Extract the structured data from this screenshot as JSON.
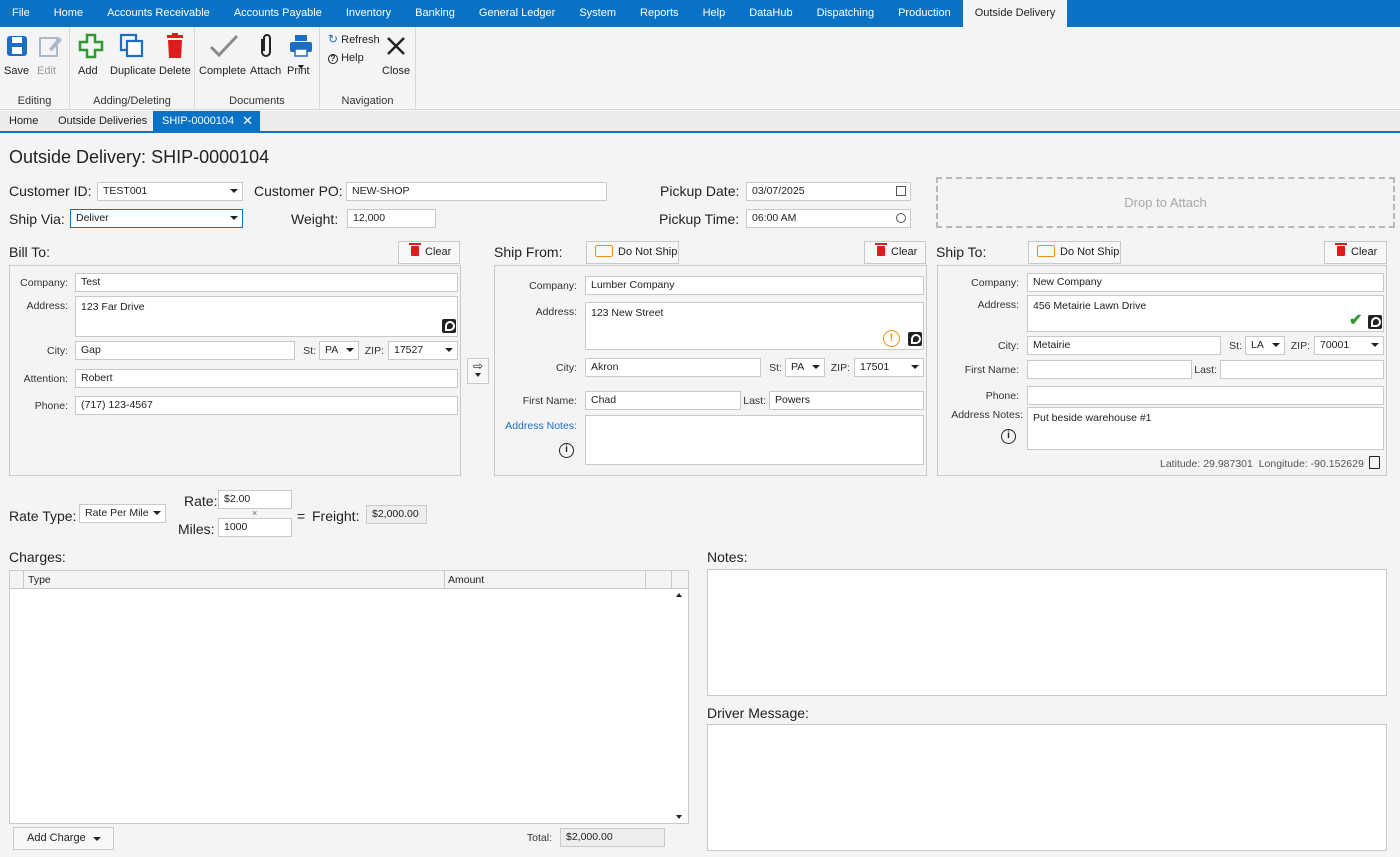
{
  "menu": [
    "File",
    "Home",
    "Accounts Receivable",
    "Accounts Payable",
    "Inventory",
    "Banking",
    "General Ledger",
    "System",
    "Reports",
    "Help",
    "DataHub",
    "Dispatching",
    "Production",
    "Outside Delivery"
  ],
  "ribbon": {
    "editing": {
      "label": "Editing",
      "save": "Save",
      "edit": "Edit"
    },
    "adding": {
      "label": "Adding/Deleting",
      "add": "Add",
      "duplicate": "Duplicate",
      "delete": "Delete"
    },
    "documents": {
      "label": "Documents",
      "complete": "Complete",
      "attach": "Attach",
      "print": "Print"
    },
    "navigation": {
      "label": "Navigation",
      "refresh": "Refresh",
      "help": "Help",
      "close": "Close"
    }
  },
  "tabs": [
    "Home",
    "Outside Deliveries",
    "SHIP-0000104"
  ],
  "title": {
    "prefix": "Outside Delivery:",
    "number": "SHIP-0000104"
  },
  "header": {
    "customer_id_label": "Customer ID:",
    "customer_id": "TEST001",
    "customer_po_label": "Customer PO:",
    "customer_po": "NEW-SHOP",
    "pickup_date_label": "Pickup Date:",
    "pickup_date": "03/07/2025",
    "ship_via_label": "Ship Via:",
    "ship_via": "Deliver",
    "weight_label": "Weight:",
    "weight": "12,000",
    "pickup_time_label": "Pickup Time:",
    "pickup_time": "06:00 AM",
    "drop_attach": "Drop to Attach"
  },
  "bill_to": {
    "title": "Bill To:",
    "clear": "Clear",
    "company_label": "Company:",
    "company": "Test",
    "address_label": "Address:",
    "address": "123 Far Drive",
    "city_label": "City:",
    "city": "Gap",
    "st_label": "St:",
    "st": "PA",
    "zip_label": "ZIP:",
    "zip": "17527",
    "attention_label": "Attention:",
    "attention": "Robert",
    "phone_label": "Phone:",
    "phone": "(717) 123-4567"
  },
  "ship_from": {
    "title": "Ship From:",
    "do_not_ship": "Do Not Ship",
    "clear": "Clear",
    "company_label": "Company:",
    "company": "Lumber Company",
    "address_label": "Address:",
    "address": "123 New Street",
    "city_label": "City:",
    "city": "Akron",
    "st_label": "St:",
    "st": "PA",
    "zip_label": "ZIP:",
    "zip": "17501",
    "first_label": "First Name:",
    "first": "Chad",
    "last_label": "Last:",
    "last": "Powers",
    "notes_label": "Address Notes:",
    "notes": ""
  },
  "ship_to": {
    "title": "Ship To:",
    "do_not_ship": "Do Not Ship",
    "clear": "Clear",
    "company_label": "Company:",
    "company": "New Company",
    "address_label": "Address:",
    "address": "456 Metairie Lawn Drive",
    "city_label": "City:",
    "city": "Metairie",
    "st_label": "St:",
    "st": "LA",
    "zip_label": "ZIP:",
    "zip": "70001",
    "first_label": "First Name:",
    "first": "",
    "last_label": "Last:",
    "last": "",
    "phone_label": "Phone:",
    "phone": "",
    "notes_label": "Address Notes:",
    "notes": "Put beside warehouse #1",
    "lat_label": "Latitude:",
    "lat": "29.987301",
    "lon_label": "Longitude:",
    "lon": "-90.152629"
  },
  "rate": {
    "rate_type_label": "Rate Type:",
    "rate_type": "Rate Per Mile",
    "rate_label": "Rate:",
    "rate": "$2.00",
    "times": "×",
    "miles_label": "Miles:",
    "miles": "1000",
    "equals": "=",
    "freight_label": "Freight:",
    "freight": "$2,000.00"
  },
  "charges": {
    "title": "Charges:",
    "col_type": "Type",
    "col_amount": "Amount",
    "add_charge": "Add Charge",
    "total_label": "Total:",
    "total": "$2,000.00"
  },
  "notes": {
    "title": "Notes:",
    "value": ""
  },
  "driver_message": {
    "title": "Driver Message:",
    "value": ""
  }
}
